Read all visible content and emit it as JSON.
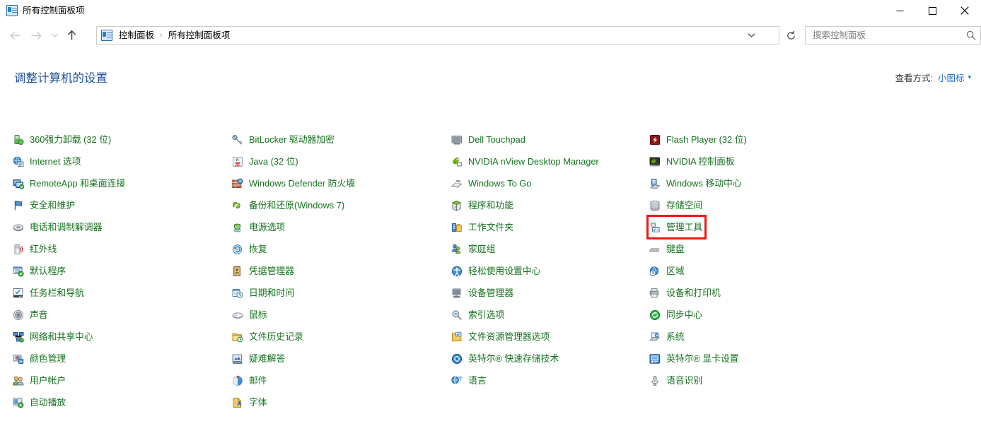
{
  "window": {
    "title": "所有控制面板项",
    "icon": "control-panel-icon",
    "controls": {
      "minimize": "最小化",
      "maximize": "最大化",
      "close": "关闭"
    }
  },
  "navbar": {
    "back": "后退",
    "forward": "前进",
    "recent": "最近浏览的位置",
    "up": "向上",
    "back_enabled": false,
    "forward_enabled": false,
    "recent_enabled": false,
    "up_enabled": true,
    "refresh": "刷新",
    "dropdown": "以前的位置"
  },
  "breadcrumb": {
    "icon": "control-panel-icon",
    "separator": "›",
    "crumbs": [
      "控制面板",
      "所有控制面板项"
    ]
  },
  "search": {
    "placeholder": "搜索控制面板",
    "value": "",
    "icon": "search-icon"
  },
  "content": {
    "heading": "调整计算机的设置",
    "viewby_label": "查看方式:",
    "viewby_value": "小图标",
    "viewby_caret": "▾"
  },
  "columns": [
    {
      "items": [
        {
          "label": "360强力卸载 (32 位)",
          "icon": "app-360-uninstall-icon",
          "highlight": false
        },
        {
          "label": "Internet 选项",
          "icon": "internet-options-icon",
          "highlight": false
        },
        {
          "label": "RemoteApp 和桌面连接",
          "icon": "remoteapp-desktop-icon",
          "highlight": false
        },
        {
          "label": "安全和维护",
          "icon": "security-maintenance-flag-icon",
          "highlight": false
        },
        {
          "label": "电话和调制解调器",
          "icon": "phone-modem-icon",
          "highlight": false
        },
        {
          "label": "红外线",
          "icon": "infrared-icon",
          "highlight": false
        },
        {
          "label": "默认程序",
          "icon": "default-programs-icon",
          "highlight": false
        },
        {
          "label": "任务栏和导航",
          "icon": "taskbar-navigation-icon",
          "highlight": false
        },
        {
          "label": "声音",
          "icon": "sound-speaker-icon",
          "highlight": false
        },
        {
          "label": "网络和共享中心",
          "icon": "network-sharing-icon",
          "highlight": false
        },
        {
          "label": "颜色管理",
          "icon": "color-management-icon",
          "highlight": false
        },
        {
          "label": "用户帐户",
          "icon": "user-accounts-icon",
          "highlight": false
        },
        {
          "label": "自动播放",
          "icon": "autoplay-icon",
          "highlight": false
        }
      ]
    },
    {
      "items": [
        {
          "label": "BitLocker 驱动器加密",
          "icon": "bitlocker-key-icon",
          "highlight": false
        },
        {
          "label": "Java (32 位)",
          "icon": "java-icon",
          "highlight": false
        },
        {
          "label": "Windows Defender 防火墙",
          "icon": "firewall-brickwall-icon",
          "highlight": false
        },
        {
          "label": "备份和还原(Windows 7)",
          "icon": "backup-restore-icon",
          "highlight": false
        },
        {
          "label": "电源选项",
          "icon": "power-options-icon",
          "highlight": false
        },
        {
          "label": "恢复",
          "icon": "recovery-icon",
          "highlight": false
        },
        {
          "label": "凭据管理器",
          "icon": "credential-manager-icon",
          "highlight": false
        },
        {
          "label": "日期和时间",
          "icon": "date-time-icon",
          "highlight": false
        },
        {
          "label": "鼠标",
          "icon": "mouse-icon",
          "highlight": false
        },
        {
          "label": "文件历史记录",
          "icon": "file-history-icon",
          "highlight": false
        },
        {
          "label": "疑难解答",
          "icon": "troubleshooting-icon",
          "highlight": false
        },
        {
          "label": "邮件",
          "icon": "mail-icon",
          "highlight": false
        },
        {
          "label": "字体",
          "icon": "fonts-icon",
          "highlight": false
        }
      ]
    },
    {
      "items": [
        {
          "label": "Dell Touchpad",
          "icon": "dell-touchpad-icon",
          "highlight": false
        },
        {
          "label": "NVIDIA nView Desktop Manager",
          "icon": "nvidia-nview-icon",
          "highlight": false
        },
        {
          "label": "Windows To Go",
          "icon": "windows-to-go-icon",
          "highlight": false
        },
        {
          "label": "程序和功能",
          "icon": "programs-features-icon",
          "highlight": false
        },
        {
          "label": "工作文件夹",
          "icon": "work-folders-icon",
          "highlight": false
        },
        {
          "label": "家庭组",
          "icon": "homegroup-icon",
          "highlight": false
        },
        {
          "label": "轻松使用设置中心",
          "icon": "ease-of-access-icon",
          "highlight": false
        },
        {
          "label": "设备管理器",
          "icon": "device-manager-icon",
          "highlight": false
        },
        {
          "label": "索引选项",
          "icon": "indexing-options-icon",
          "highlight": false
        },
        {
          "label": "文件资源管理器选项",
          "icon": "file-explorer-options-icon",
          "highlight": false
        },
        {
          "label": "英特尔® 快速存储技术",
          "icon": "intel-rapid-storage-icon",
          "highlight": false
        },
        {
          "label": "语言",
          "icon": "language-icon",
          "highlight": false
        }
      ]
    },
    {
      "items": [
        {
          "label": "Flash Player (32 位)",
          "icon": "flash-player-icon",
          "highlight": false
        },
        {
          "label": "NVIDIA 控制面板",
          "icon": "nvidia-control-panel-icon",
          "highlight": false
        },
        {
          "label": "Windows 移动中心",
          "icon": "windows-mobility-center-icon",
          "highlight": false
        },
        {
          "label": "存储空间",
          "icon": "storage-spaces-icon",
          "highlight": false
        },
        {
          "label": "管理工具",
          "icon": "administrative-tools-icon",
          "highlight": true
        },
        {
          "label": "键盘",
          "icon": "keyboard-icon",
          "highlight": false
        },
        {
          "label": "区域",
          "icon": "region-icon",
          "highlight": false
        },
        {
          "label": "设备和打印机",
          "icon": "devices-printers-icon",
          "highlight": false
        },
        {
          "label": "同步中心",
          "icon": "sync-center-icon",
          "highlight": false
        },
        {
          "label": "系统",
          "icon": "system-icon",
          "highlight": false
        },
        {
          "label": "英特尔® 显卡设置",
          "icon": "intel-graphics-settings-icon",
          "highlight": false
        },
        {
          "label": "语音识别",
          "icon": "speech-recognition-icon",
          "highlight": false
        }
      ]
    }
  ],
  "colors": {
    "item_text": "#15721d",
    "heading": "#1e4f9c",
    "link": "#1a6cc4",
    "highlight_box": "#f41414",
    "window_bg": "#ffffff"
  }
}
